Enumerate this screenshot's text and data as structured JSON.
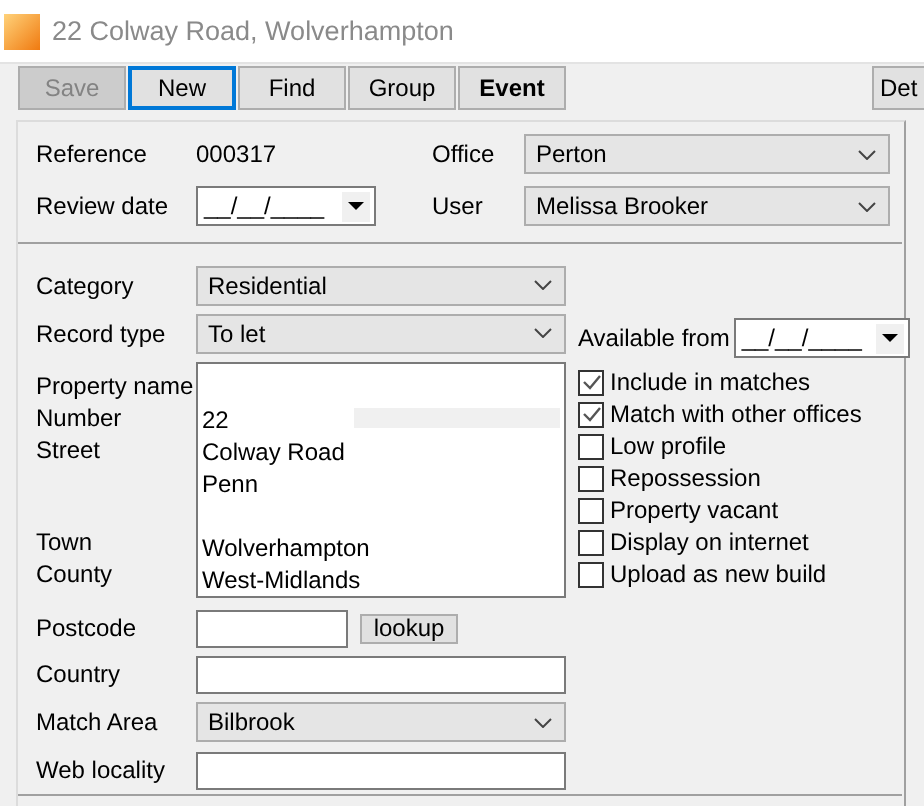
{
  "window": {
    "title": "22 Colway Road, Wolverhampton"
  },
  "toolbar": [
    {
      "label": "Save",
      "disabled": true,
      "focused": false,
      "bold": false
    },
    {
      "label": "New",
      "disabled": false,
      "focused": true,
      "bold": false
    },
    {
      "label": "Find",
      "disabled": false,
      "focused": false,
      "bold": false
    },
    {
      "label": "Group",
      "disabled": false,
      "focused": false,
      "bold": false
    },
    {
      "label": "Event",
      "disabled": false,
      "focused": false,
      "bold": true
    }
  ],
  "toolbar_right": {
    "label": "Det"
  },
  "header": {
    "reference": {
      "label": "Reference",
      "value": "000317"
    },
    "review_date": {
      "label": "Review date",
      "value": "__/__/____"
    },
    "office": {
      "label": "Office",
      "value": "Perton"
    },
    "user": {
      "label": "User",
      "value": "Melissa Brooker"
    }
  },
  "property": {
    "category": {
      "label": "Category",
      "value": "Residential"
    },
    "record_type": {
      "label": "Record type",
      "value": "To let"
    },
    "address_lines": [
      {
        "label": "Property name"
      },
      {
        "label": "Number",
        "value": "22"
      },
      {
        "label": "Street",
        "value": "Colway Road"
      },
      {
        "value": "Penn"
      },
      {
        "kind": "blank"
      },
      {
        "label": "Town",
        "value": "Wolverhampton"
      },
      {
        "label": "County",
        "value": "West-Midlands"
      }
    ],
    "postcode": {
      "label": "Postcode",
      "button": "lookup"
    },
    "country": {
      "label": "Country"
    },
    "match_area": {
      "label": "Match Area",
      "value": "Bilbrook"
    },
    "web_locality": {
      "label": "Web locality"
    },
    "available_from": {
      "label": "Available from",
      "value": "__/__/____"
    },
    "options": [
      {
        "label": "Include in matches",
        "checked": true
      },
      {
        "label": "Match with other offices",
        "checked": true
      },
      {
        "label": "Low profile",
        "checked": false
      },
      {
        "label": "Repossession",
        "checked": false
      },
      {
        "label": "Property vacant",
        "checked": false
      },
      {
        "label": "Display on internet",
        "checked": false
      },
      {
        "label": "Upload as new build",
        "checked": false
      }
    ]
  }
}
